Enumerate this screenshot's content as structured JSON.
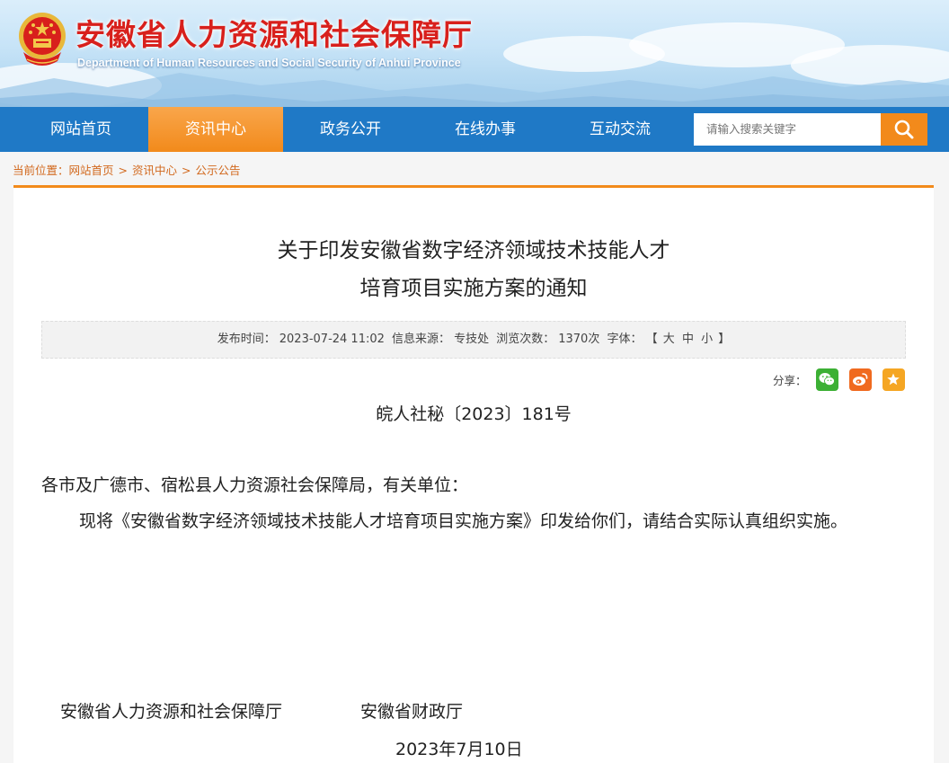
{
  "site": {
    "title": "安徽省人力资源和社会保障厅",
    "subtitle": "Department of Human Resources and Social Security of Anhui Province"
  },
  "nav": {
    "items": [
      {
        "label": "网站首页",
        "active": false
      },
      {
        "label": "资讯中心",
        "active": true
      },
      {
        "label": "政务公开",
        "active": false
      },
      {
        "label": "在线办事",
        "active": false
      },
      {
        "label": "互动交流",
        "active": false
      }
    ],
    "search_placeholder": "请输入搜索关键字",
    "search_icon": "search-icon"
  },
  "breadcrumb": {
    "label": "当前位置：",
    "items": [
      "网站首页",
      "资讯中心",
      "公示公告"
    ],
    "separator": ">"
  },
  "article": {
    "title_line1": "关于印发安徽省数字经济领域技术技能人才",
    "title_line2": "培育项目实施方案的通知",
    "meta": {
      "publish_label": "发布时间：",
      "publish_time": "2023-07-24 11:02",
      "source_label": "信息来源：",
      "source": "专技处",
      "views_label": "浏览次数：",
      "views": "1370次",
      "font_label": "字体：",
      "font_open": "【",
      "font_large": "大",
      "font_medium": "中",
      "font_small": "小",
      "font_close": "】"
    },
    "share_label": "分享：",
    "share_icons": [
      "wechat-icon",
      "weibo-icon",
      "favorite-icon"
    ],
    "doc_number": "皖人社秘〔2023〕181号",
    "recipients": "各市及广德市、宿松县人力资源社会保障局，有关单位：",
    "body": "现将《安徽省数字经济领域技术技能人才培育项目实施方案》印发给你们，请结合实际认真组织实施。",
    "signer1": "安徽省人力资源和社会保障厅",
    "signer2": "安徽省财政厅",
    "date": "2023年7月10日"
  },
  "colors": {
    "nav_blue": "#1f79c6",
    "accent_orange": "#f28a1b",
    "title_red": "#d8201c",
    "wechat_green": "#3cb034",
    "weibo_orange": "#f06a1f",
    "favorite_orange": "#f5a623"
  }
}
